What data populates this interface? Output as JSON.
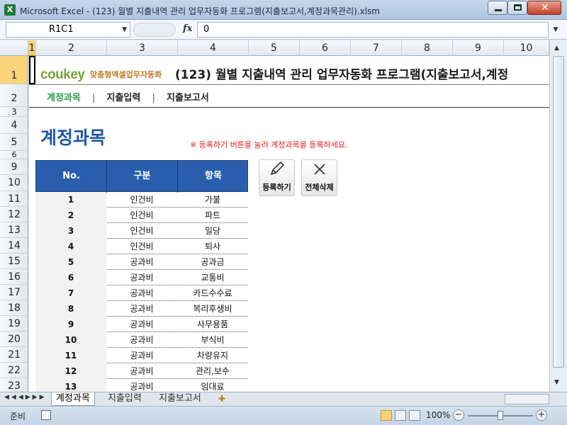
{
  "window": {
    "app_icon": "X",
    "title": "Microsoft Excel - (123) 월별 지출내역 관리 업무자동화 프로그램(지출보고서,계정과목관리).xlsm"
  },
  "formula_bar": {
    "name_box": "R1C1",
    "fx": "fx",
    "value": "0"
  },
  "columns": [
    "1",
    "2",
    "3",
    "4",
    "5",
    "6",
    "7",
    "8",
    "9",
    "10"
  ],
  "rows": [
    "1",
    "2",
    "3",
    "4",
    "5",
    "6",
    "9",
    "10",
    "11",
    "12",
    "13",
    "14",
    "15",
    "16",
    "17",
    "18",
    "19",
    "20",
    "21",
    "22",
    "23"
  ],
  "header": {
    "logo": "coukey",
    "logo_sub": "맞춤형엑셀업무자동화",
    "title": "(123) 월별 지출내역 관리 업무자동화 프로그램(지출보고서,계정",
    "line_color": "#7f7f7f"
  },
  "menu": {
    "items": [
      "계정과목",
      "지출입력",
      "지출보고서"
    ],
    "separator": "|",
    "active_color": "#2e9c4a"
  },
  "page": {
    "title": "계정과목",
    "notice": "※ 등록하기 버튼을 눌러 계정과목을 등록하세요.",
    "title_color": "#1f56a5",
    "notice_color": "#e0201c"
  },
  "table": {
    "headers": [
      "No.",
      "구분",
      "항목"
    ],
    "header_color": "#2a5ead",
    "rows": [
      {
        "no": "1",
        "category": "인건비",
        "item": "가불"
      },
      {
        "no": "2",
        "category": "인건비",
        "item": "파트"
      },
      {
        "no": "3",
        "category": "인건비",
        "item": "일당"
      },
      {
        "no": "4",
        "category": "인건비",
        "item": "퇴사"
      },
      {
        "no": "5",
        "category": "공과비",
        "item": "공과금"
      },
      {
        "no": "6",
        "category": "공과비",
        "item": "교통비"
      },
      {
        "no": "7",
        "category": "공과비",
        "item": "카드수수료"
      },
      {
        "no": "8",
        "category": "공과비",
        "item": "복리후생비"
      },
      {
        "no": "9",
        "category": "공과비",
        "item": "사무용품"
      },
      {
        "no": "10",
        "category": "공과비",
        "item": "부식비"
      },
      {
        "no": "11",
        "category": "공과비",
        "item": "차량유지"
      },
      {
        "no": "12",
        "category": "공과비",
        "item": "관리,보수"
      },
      {
        "no": "13",
        "category": "공과비",
        "item": "임대료"
      }
    ]
  },
  "buttons": {
    "register": {
      "label": "등록하기",
      "icon": "pencil-icon"
    },
    "delete_all": {
      "label": "전체삭제",
      "icon": "close-icon"
    }
  },
  "sheet_tabs": [
    "계정과목",
    "지출입력",
    "지출보고서"
  ],
  "status": {
    "ready": "준비",
    "zoom": "100%"
  }
}
